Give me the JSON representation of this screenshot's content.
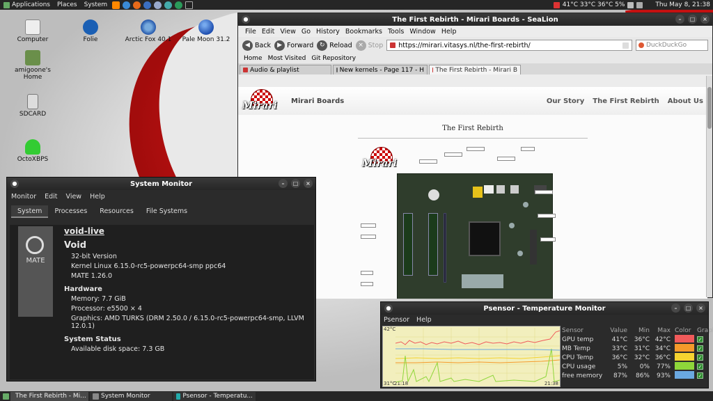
{
  "top_panel": {
    "menus": [
      "Applications",
      "Places",
      "System"
    ],
    "temps": "41°C 33°C 36°C 5%",
    "clock": "Thu May  8, 21:38"
  },
  "desktop_icons": [
    {
      "label": "Computer"
    },
    {
      "label": "Folie"
    },
    {
      "label": "Arctic Fox 40.1"
    },
    {
      "label": "Pale Moon 31.2"
    },
    {
      "label": "amigoone's Home"
    },
    {
      "label": "SDCARD"
    },
    {
      "label": "OctoXBPS"
    }
  ],
  "browser": {
    "title": "The First Rebirth - Mirari Boards - SeaLion",
    "menu": [
      "File",
      "Edit",
      "View",
      "Go",
      "History",
      "Bookmarks",
      "Tools",
      "Window",
      "Help"
    ],
    "nav": {
      "back": "Back",
      "forward": "Forward",
      "reload": "Reload",
      "stop": "Stop"
    },
    "url": "https://mirari.vitasys.nl/the-first-rebirth/",
    "search_placeholder": "DuckDuckGo",
    "bookmarks": [
      "Home",
      "Most Visited",
      "Git Repository"
    ],
    "tabs": [
      "Audio & playlist",
      "New kernels - Page 117 - H",
      "The First Rebirth - Mirari B"
    ],
    "site": {
      "logo_text": "Mirari",
      "name": "Mirari Boards",
      "nav": [
        "Our Story",
        "The First Rebirth",
        "About Us"
      ],
      "page_title": "The First Rebirth"
    }
  },
  "sysmon": {
    "title": "System Monitor",
    "menu": [
      "Monitor",
      "Edit",
      "View",
      "Help"
    ],
    "tabs": [
      "System",
      "Processes",
      "Resources",
      "File Systems"
    ],
    "logo_label": "MATE",
    "hostname": "void-live",
    "distro": "Void",
    "version": "32-bit Version",
    "kernel": "Kernel Linux 6.15.0-rc5-powerpc64-smp ppc64",
    "mate": "MATE 1.26.0",
    "hardware_heading": "Hardware",
    "memory": "Memory:    7.7 GiB",
    "processor": "Processor: e5500 × 4",
    "graphics": "Graphics:   AMD TURKS (DRM 2.50.0 / 6.15.0-rc5-powerpc64-smp, LLVM 12.0.1)",
    "status_heading": "System Status",
    "disk": "Available disk space: 7.3 GB"
  },
  "psensor": {
    "title": "Psensor - Temperature Monitor",
    "menu": [
      "Psensor",
      "Help"
    ],
    "graph": {
      "ymax": "42°C",
      "ymin": "31°C",
      "tstart": "21:18",
      "tend": "21:38"
    },
    "headers": [
      "Sensor",
      "Value",
      "Min",
      "Max",
      "Color",
      "Graph"
    ],
    "rows": [
      {
        "sensor": "GPU temp",
        "value": "41°C",
        "min": "36°C",
        "max": "42°C",
        "color": "#f05a5a"
      },
      {
        "sensor": "MB Temp",
        "value": "33°C",
        "min": "31°C",
        "max": "34°C",
        "color": "#f59a2a"
      },
      {
        "sensor": "CPU Temp",
        "value": "36°C",
        "min": "32°C",
        "max": "36°C",
        "color": "#f5d330"
      },
      {
        "sensor": "CPU usage",
        "value": "5%",
        "min": "0%",
        "max": "77%",
        "color": "#8ed63a"
      },
      {
        "sensor": "free memory",
        "value": "87%",
        "min": "86%",
        "max": "93%",
        "color": "#6aa8e0"
      }
    ]
  },
  "taskbar": [
    "The First Rebirth - Mi...",
    "System Monitor",
    "Psensor - Temperatu..."
  ]
}
